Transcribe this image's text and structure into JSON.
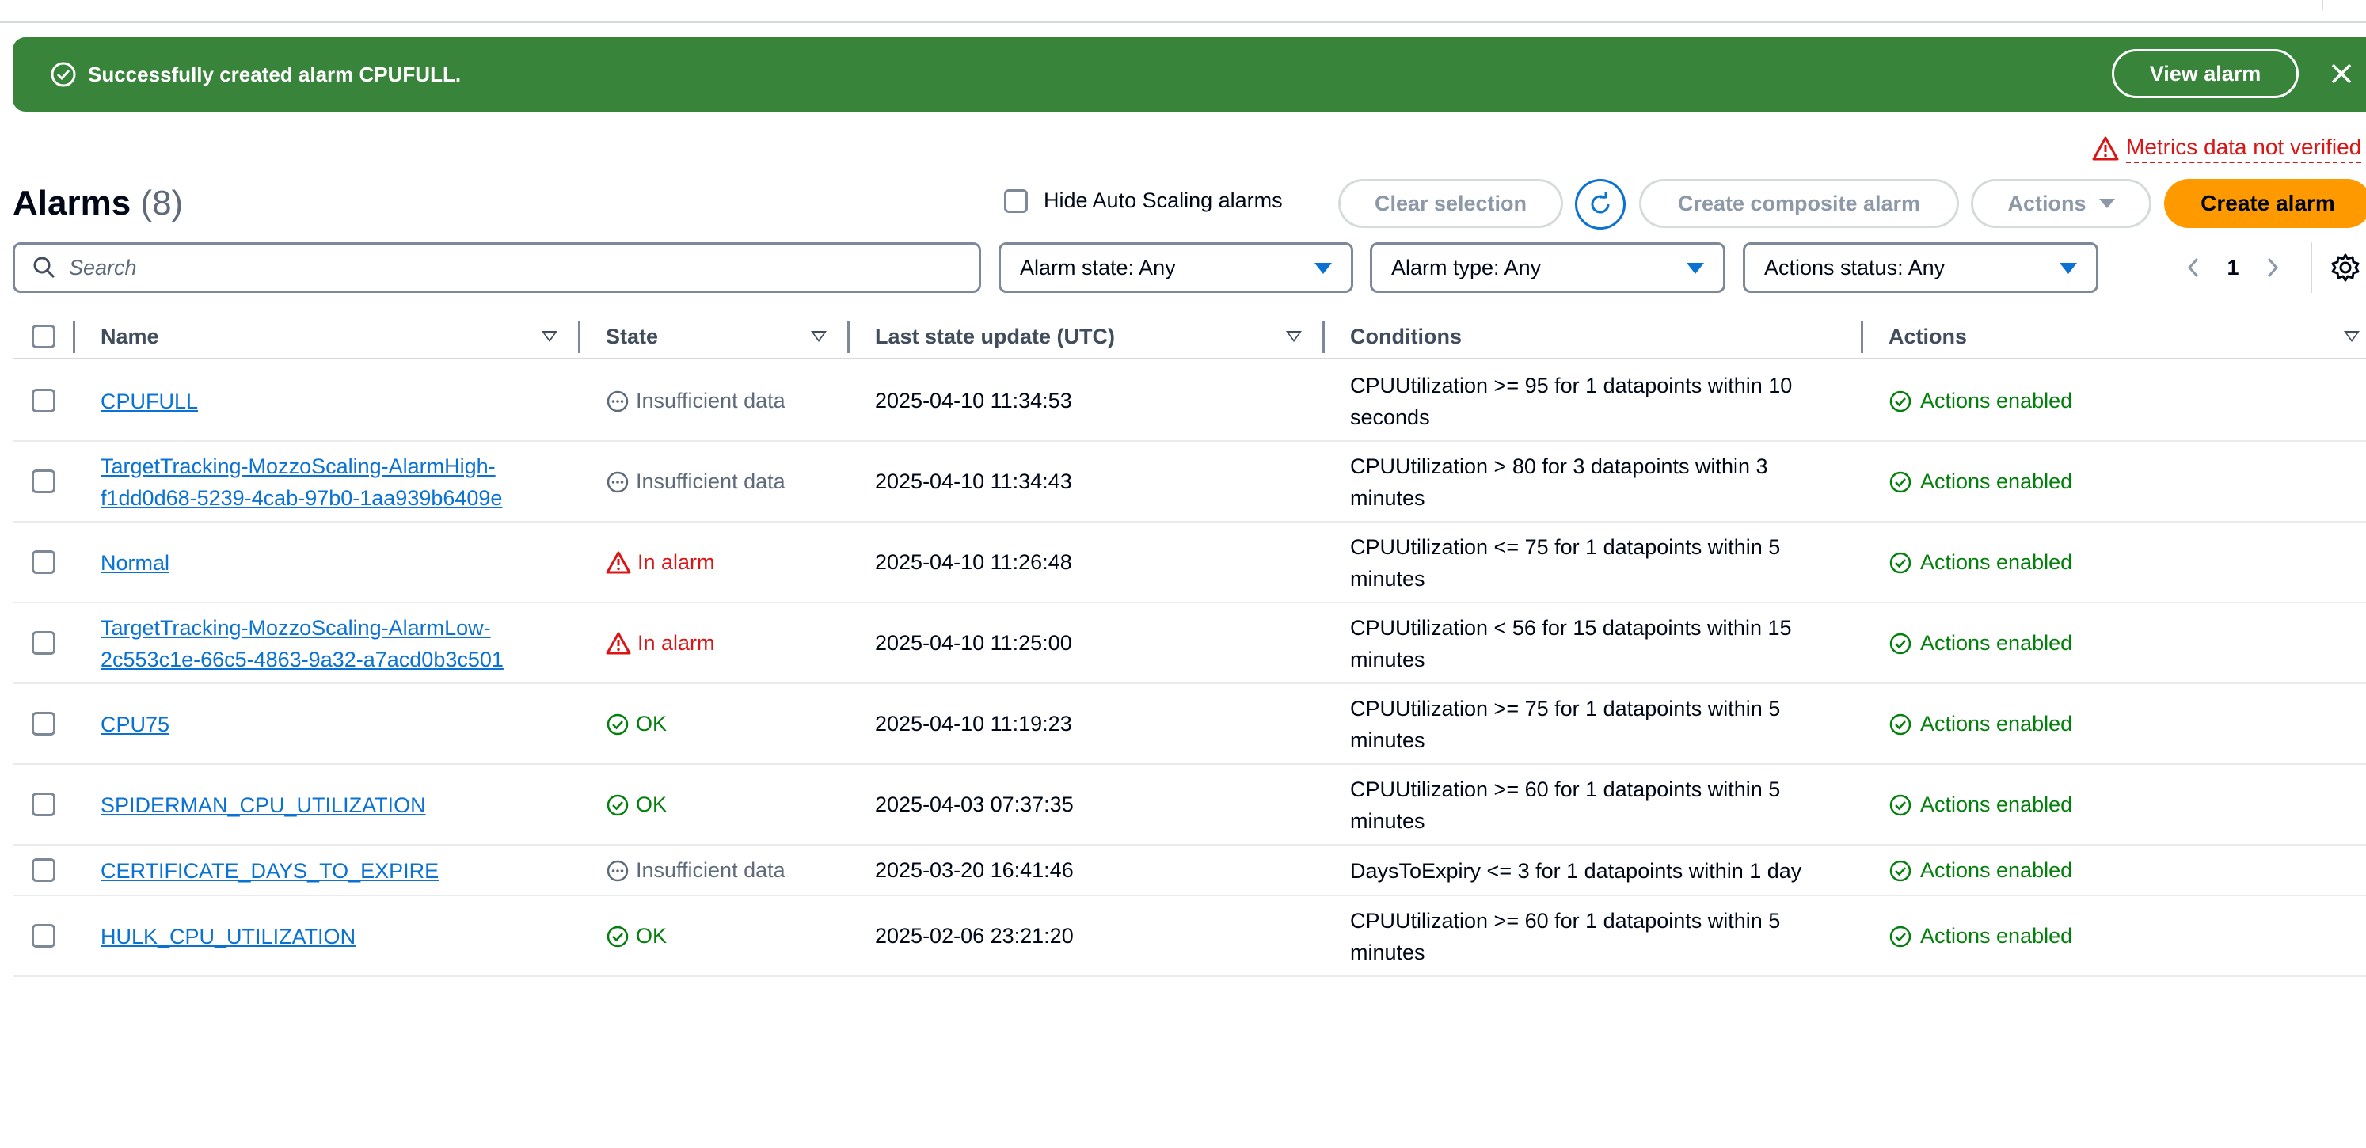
{
  "flash": {
    "message": "Successfully created alarm CPUFULL.",
    "view_label": "View alarm",
    "color": "#37843a"
  },
  "warning": {
    "text": "Metrics data not verified"
  },
  "header": {
    "title": "Alarms",
    "count": "(8)",
    "hide_autoscaling_label": "Hide Auto Scaling alarms",
    "clear_label": "Clear selection",
    "composite_label": "Create composite alarm",
    "actions_label": "Actions",
    "create_label": "Create alarm",
    "accent": "#ff9900"
  },
  "filters": {
    "search_placeholder": "Search",
    "alarm_state": "Alarm state: Any",
    "alarm_type": "Alarm type: Any",
    "actions_status": "Actions status: Any",
    "page": "1"
  },
  "columns": {
    "name": "Name",
    "state": "State",
    "last_update": "Last state update (UTC)",
    "conditions": "Conditions",
    "actions": "Actions"
  },
  "rows": [
    {
      "name": [
        "CPUFULL"
      ],
      "state": "Insufficient data",
      "state_kind": "insufficient",
      "updated": "2025-04-10 11:34:53",
      "conditions": [
        "CPUUtilization >= 95 for 1 datapoints within 10",
        "seconds"
      ],
      "actions": "Actions enabled"
    },
    {
      "name": [
        "TargetTracking-MozzoScaling-AlarmHigh-",
        "f1dd0d68-5239-4cab-97b0-1aa939b6409e"
      ],
      "state": "Insufficient data",
      "state_kind": "insufficient",
      "updated": "2025-04-10 11:34:43",
      "conditions": [
        "CPUUtilization > 80 for 3 datapoints within 3",
        "minutes"
      ],
      "actions": "Actions enabled"
    },
    {
      "name": [
        "Normal"
      ],
      "state": "In alarm",
      "state_kind": "alarm",
      "updated": "2025-04-10 11:26:48",
      "conditions": [
        "CPUUtilization <= 75 for 1 datapoints within 5",
        "minutes"
      ],
      "actions": "Actions enabled"
    },
    {
      "name": [
        "TargetTracking-MozzoScaling-AlarmLow-",
        "2c553c1e-66c5-4863-9a32-a7acd0b3c501"
      ],
      "state": "In alarm",
      "state_kind": "alarm",
      "updated": "2025-04-10 11:25:00",
      "conditions": [
        "CPUUtilization < 56 for 15 datapoints within 15",
        "minutes"
      ],
      "actions": "Actions enabled"
    },
    {
      "name": [
        "CPU75"
      ],
      "state": "OK",
      "state_kind": "ok",
      "updated": "2025-04-10 11:19:23",
      "conditions": [
        "CPUUtilization >= 75 for 1 datapoints within 5",
        "minutes"
      ],
      "actions": "Actions enabled"
    },
    {
      "name": [
        "SPIDERMAN_CPU_UTILIZATION"
      ],
      "state": "OK",
      "state_kind": "ok",
      "updated": "2025-04-03 07:37:35",
      "conditions": [
        "CPUUtilization >= 60 for 1 datapoints within 5",
        "minutes"
      ],
      "actions": "Actions enabled"
    },
    {
      "name": [
        "CERTIFICATE_DAYS_TO_EXPIRE"
      ],
      "state": "Insufficient data",
      "state_kind": "insufficient",
      "updated": "2025-03-20 16:41:46",
      "conditions": [
        "DaysToExpiry <= 3 for 1 datapoints within 1 day"
      ],
      "actions": "Actions enabled"
    },
    {
      "name": [
        "HULK_CPU_UTILIZATION"
      ],
      "state": "OK",
      "state_kind": "ok",
      "updated": "2025-02-06 23:21:20",
      "conditions": [
        "CPUUtilization >= 60 for 1 datapoints within 5",
        "minutes"
      ],
      "actions": "Actions enabled"
    }
  ]
}
